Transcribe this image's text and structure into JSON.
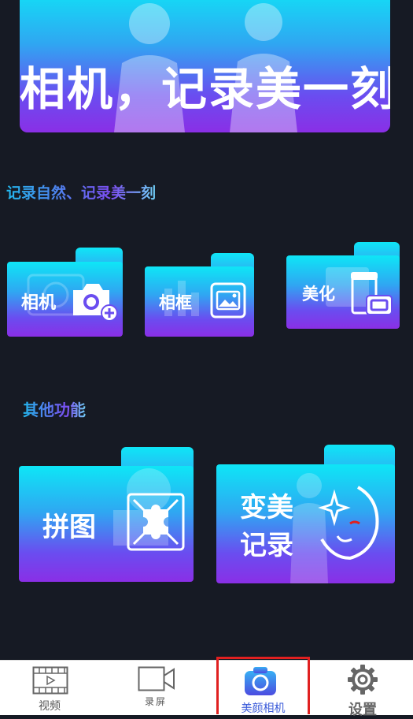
{
  "banner": {
    "title": "相机，记录美一刻"
  },
  "sections": {
    "record": {
      "title": "记录自然、记录美一刻"
    },
    "other": {
      "title": "其他功能"
    }
  },
  "cards": {
    "camera": {
      "label": "相机",
      "icon": "camera-plus-icon"
    },
    "frame": {
      "label": "相框",
      "icon": "picture-frame-icon"
    },
    "beautify": {
      "label": "美化",
      "icon": "cosmetics-icon"
    },
    "collage": {
      "label": "拼图",
      "icon": "puzzle-icon"
    },
    "beauty_record_line1": "变美",
    "beauty_record_line2": "记录",
    "beauty_record_icon": "face-sparkle-icon"
  },
  "tabbar": {
    "items": [
      {
        "label": "视频",
        "icon": "film-icon"
      },
      {
        "label": "录屏",
        "icon": "video-camera-icon"
      },
      {
        "label": "美颜相机",
        "icon": "camera-icon"
      },
      {
        "label": "设置",
        "icon": "gear-icon"
      }
    ],
    "active_index": 2
  },
  "colors": {
    "background": "#161a24",
    "gradient_top": "#0ee6f6",
    "gradient_bottom": "#8a2fe6",
    "active_tab_border": "#e02020",
    "active_tab_text": "#3a5bd9"
  }
}
